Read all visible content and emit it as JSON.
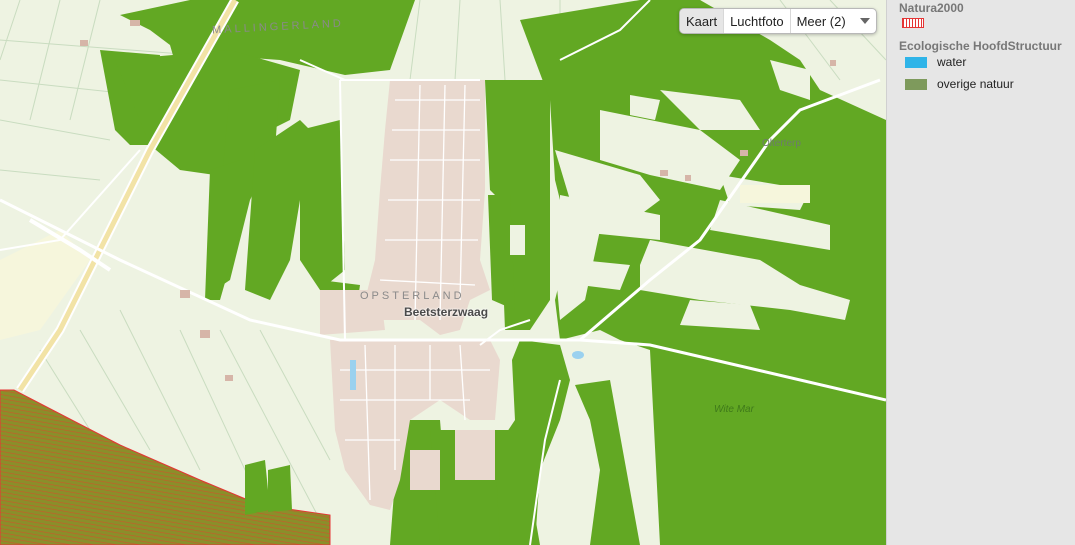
{
  "map": {
    "labels": {
      "region_top": "MALLINGERLAND",
      "region_mid": "OPSTERLAND",
      "town": "Beetsterzwaag",
      "village": "Olterterp",
      "nature": "Wite Mar"
    },
    "colors": {
      "background": "#eef3e2",
      "nature": "#62a823",
      "urban": "#e9d9cf",
      "natura2000": "#e53535"
    },
    "icons": [
      "chevron-down-icon"
    ]
  },
  "map_type": {
    "options": [
      "Kaart",
      "Luchtfoto"
    ],
    "active": "Kaart",
    "more_label": "Meer (2)"
  },
  "legend": {
    "natura_title": "Natura2000",
    "ehs_title": "Ecologische HoofdStructuur",
    "items": [
      {
        "label": "water",
        "color": "#2fb4e8"
      },
      {
        "label": "overige natuur",
        "color": "#7e9a5c"
      }
    ]
  }
}
